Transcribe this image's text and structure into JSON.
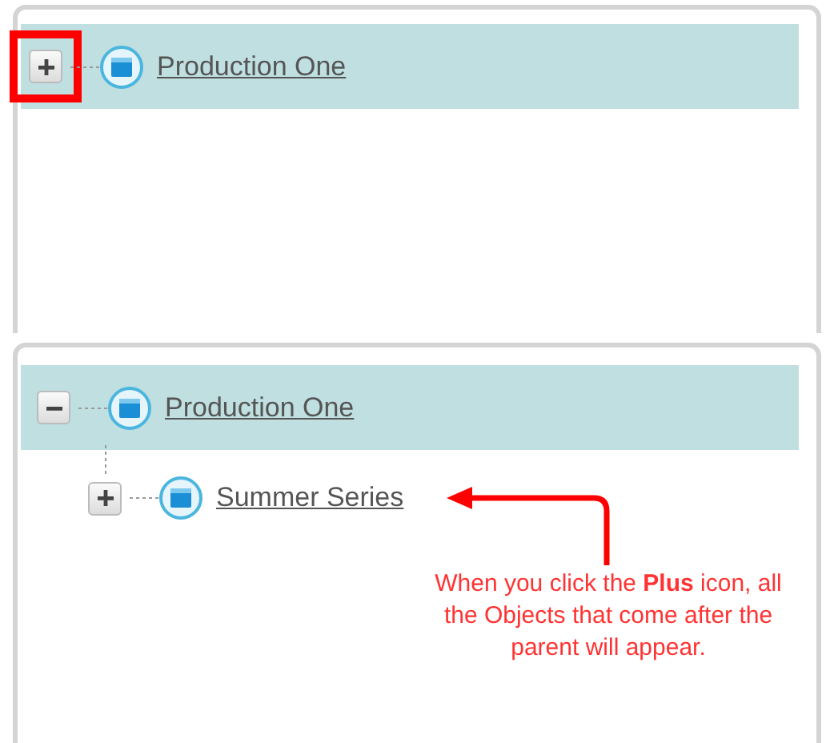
{
  "panels": [
    {
      "tree": [
        {
          "label": "Production One",
          "expanded": false,
          "selected": true,
          "toggle_marked": true
        }
      ]
    },
    {
      "tree": [
        {
          "label": "Production One",
          "expanded": true,
          "selected": true,
          "toggle_marked": false,
          "children": [
            {
              "label": "Summer Series",
              "expanded": false,
              "selected": false,
              "toggle_marked": false
            }
          ]
        }
      ],
      "callout": {
        "text": "When you click the **Plus** icon, all the Objects that come after the parent will appear."
      }
    }
  ]
}
